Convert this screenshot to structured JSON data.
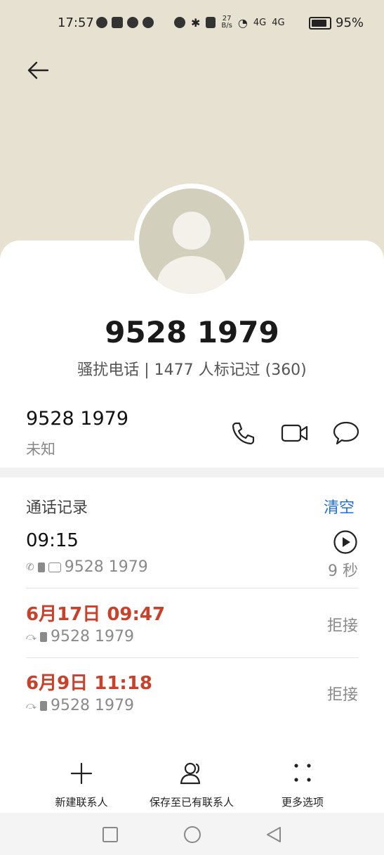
{
  "status_bar": {
    "time": "17:57",
    "speed_top": "27",
    "speed_bottom": "B/s",
    "net1": "4G",
    "net2": "4G",
    "battery": "95%"
  },
  "contact": {
    "number_display": "9528 1979",
    "tag_line": "骚扰电话 | 1477 人标记过 (360)",
    "number": "9528 1979",
    "location": "未知"
  },
  "call_log": {
    "title": "通话记录",
    "clear_label": "清空",
    "entries": [
      {
        "time": "09:15",
        "number": "9528 1979",
        "status": "9 秒"
      },
      {
        "time": "6月17日 09:47",
        "number": "9528 1979",
        "status": "拒接"
      },
      {
        "time": "6月9日 11:18",
        "number": "9528 1979",
        "status": "拒接"
      }
    ]
  },
  "bottom_actions": {
    "new_contact": "新建联系人",
    "save_existing": "保存至已有联系人",
    "more": "更多选项"
  },
  "colors": {
    "header_bg": "#e6e1d1",
    "accent_blue": "#1e6fd9",
    "missed_red": "#c7412b"
  },
  "icons": [
    "back-arrow-icon",
    "phone-icon",
    "video-call-icon",
    "message-icon",
    "play-icon",
    "plus-icon",
    "person-icon",
    "more-dots-icon"
  ]
}
